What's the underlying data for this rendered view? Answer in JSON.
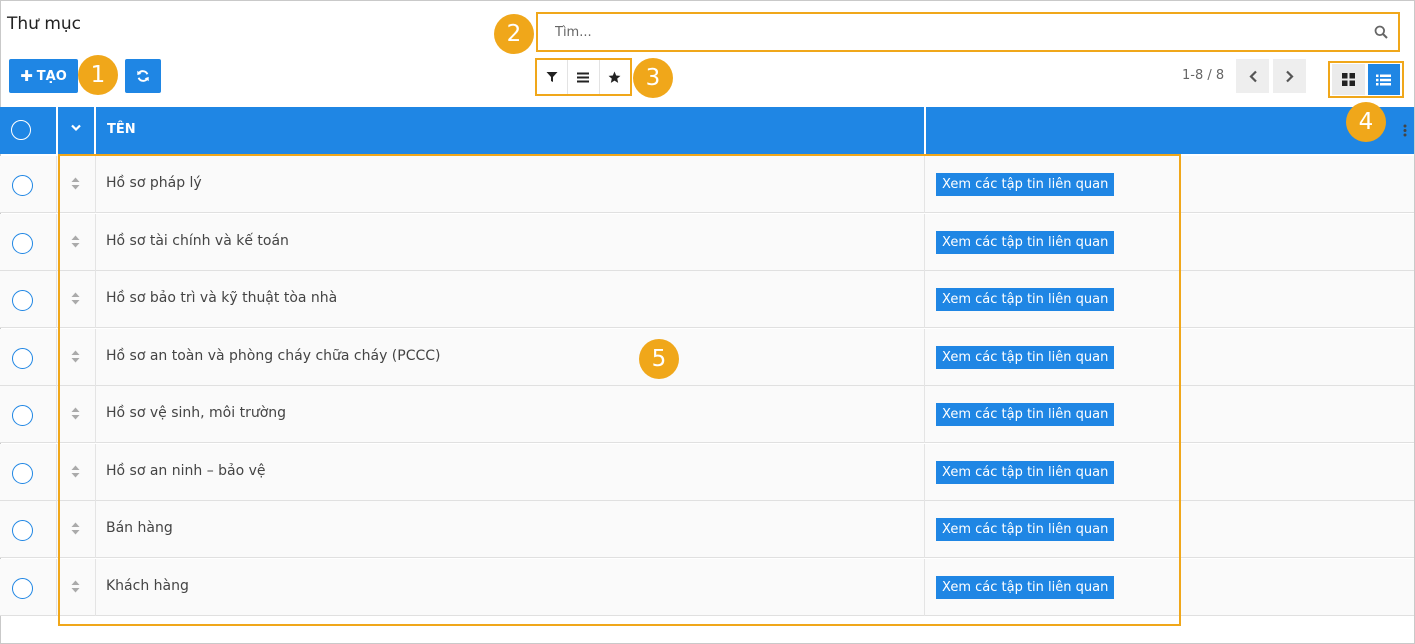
{
  "page": {
    "title": "Thư mục"
  },
  "toolbar": {
    "create_label": "TẠO"
  },
  "search": {
    "placeholder": "Tìm..."
  },
  "pager": {
    "value": "1-8 / 8"
  },
  "table": {
    "name_header": "TÊN",
    "rows": [
      {
        "name": "Hồ sơ pháp lý",
        "action": "Xem các tập tin liên quan"
      },
      {
        "name": "Hồ sơ tài chính và kế toán",
        "action": "Xem các tập tin liên quan"
      },
      {
        "name": "Hồ sơ bảo trì và kỹ thuật tòa nhà",
        "action": "Xem các tập tin liên quan"
      },
      {
        "name": "Hồ sơ an toàn và phòng cháy chữa cháy (PCCC)",
        "action": "Xem các tập tin liên quan"
      },
      {
        "name": "Hồ sơ vệ sinh, môi trường",
        "action": "Xem các tập tin liên quan"
      },
      {
        "name": "Hồ sơ an ninh – bảo vệ",
        "action": "Xem các tập tin liên quan"
      },
      {
        "name": "Bán hàng",
        "action": "Xem các tập tin liên quan"
      },
      {
        "name": "Khách hàng",
        "action": "Xem các tập tin liên quan"
      }
    ]
  },
  "callouts": [
    "1",
    "2",
    "3",
    "4",
    "5"
  ],
  "colors": {
    "accent": "#1f86e4",
    "callout": "#f0a71a",
    "row_bg": "#fafafa"
  },
  "icons": {
    "refresh": "refresh-icon",
    "search": "search-icon",
    "filter": "filter-icon",
    "group_by": "group-by-icon",
    "favorites": "star-icon",
    "prev": "chevron-left-icon",
    "next": "chevron-right-icon",
    "kanban": "kanban-view-icon",
    "list": "list-view-icon",
    "drag": "drag-handle-icon",
    "options": "kebab-icon"
  }
}
